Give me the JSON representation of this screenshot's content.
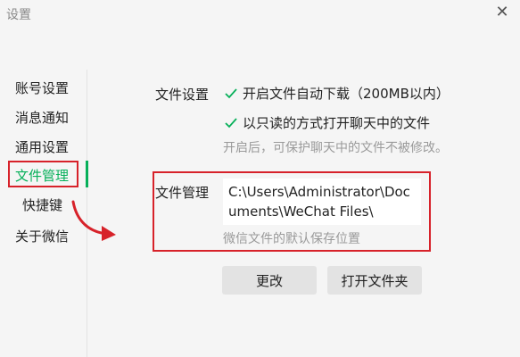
{
  "window": {
    "title": "设置"
  },
  "icons": {
    "close": "close-icon",
    "check": "check-icon",
    "arrow": "curved-arrow-icon"
  },
  "colors": {
    "accent": "#07b05a",
    "highlight": "#d7222a",
    "hint": "#9a9a9a"
  },
  "sidebar": {
    "items": [
      {
        "label": "账号设置"
      },
      {
        "label": "消息通知"
      },
      {
        "label": "通用设置"
      },
      {
        "label": "文件管理",
        "active": true
      },
      {
        "label": "快捷键"
      },
      {
        "label": "关于微信"
      }
    ]
  },
  "file_settings": {
    "label": "文件设置",
    "options": [
      {
        "label": "开启文件自动下载（200MB以内）",
        "checked": true
      },
      {
        "label": "以只读的方式打开聊天中的文件",
        "checked": true
      }
    ],
    "hint": "开启后，可保护聊天中的文件不被修改。"
  },
  "file_management": {
    "label": "文件管理",
    "path": "C:\\Users\\Administrator\\Documents\\WeChat Files\\",
    "hint": "微信文件的默认保存位置"
  },
  "buttons": {
    "change": "更改",
    "open_folder": "打开文件夹"
  }
}
